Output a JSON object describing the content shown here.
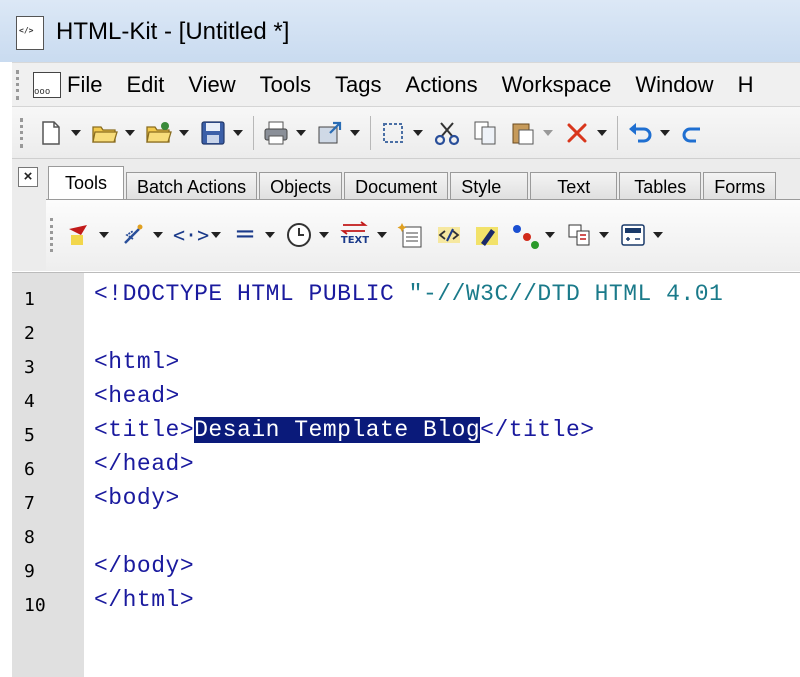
{
  "window": {
    "title": "HTML-Kit - [Untitled *]"
  },
  "menu": [
    {
      "label": "File"
    },
    {
      "label": "Edit"
    },
    {
      "label": "View"
    },
    {
      "label": "Tools"
    },
    {
      "label": "Tags"
    },
    {
      "label": "Actions"
    },
    {
      "label": "Workspace"
    },
    {
      "label": "Window"
    },
    {
      "label": "H"
    }
  ],
  "toolbar": {
    "icons": [
      "new-file-icon",
      "open-folder-icon",
      "open-recent-icon",
      "save-icon",
      "print-icon",
      "publish-icon",
      "select-icon",
      "cut-icon",
      "copy-icon",
      "paste-icon",
      "delete-icon",
      "undo-icon"
    ]
  },
  "tabs": [
    {
      "label": "Tools",
      "active": true
    },
    {
      "label": "Batch Actions"
    },
    {
      "label": "Objects"
    },
    {
      "label": "Document"
    },
    {
      "label": "Style"
    },
    {
      "label": "Text"
    },
    {
      "label": "Tables"
    },
    {
      "label": "Forms"
    }
  ],
  "tab_toolbar": {
    "text_icon_label": "TEXT",
    "equals_label": "=",
    "angle_label": "<·>"
  },
  "editor": {
    "lines": [
      {
        "num": "1",
        "parts": [
          {
            "t": "<!DOCTYPE HTML PUBLIC ",
            "c": ""
          },
          {
            "t": "\"-//W3C//DTD HTML 4.01",
            "c": "str"
          }
        ]
      },
      {
        "num": "2",
        "parts": []
      },
      {
        "num": "3",
        "parts": [
          {
            "t": "<html>",
            "c": ""
          }
        ]
      },
      {
        "num": "4",
        "parts": [
          {
            "t": "<head>",
            "c": ""
          }
        ]
      },
      {
        "num": "5",
        "parts": [
          {
            "t": "<title>",
            "c": ""
          },
          {
            "t": "Desain Template Blog",
            "c": "sel"
          },
          {
            "t": "</title>",
            "c": ""
          }
        ]
      },
      {
        "num": "6",
        "parts": [
          {
            "t": "</head>",
            "c": ""
          }
        ]
      },
      {
        "num": "7",
        "parts": [
          {
            "t": "<body>",
            "c": ""
          }
        ]
      },
      {
        "num": "8",
        "parts": []
      },
      {
        "num": "9",
        "parts": [
          {
            "t": "</body>",
            "c": ""
          }
        ]
      },
      {
        "num": "10",
        "parts": [
          {
            "t": "</html>",
            "c": ""
          }
        ]
      }
    ]
  },
  "colors": {
    "selection": "#0a1a7a",
    "code": "#1a1a9e",
    "string": "#1a7a8a"
  }
}
